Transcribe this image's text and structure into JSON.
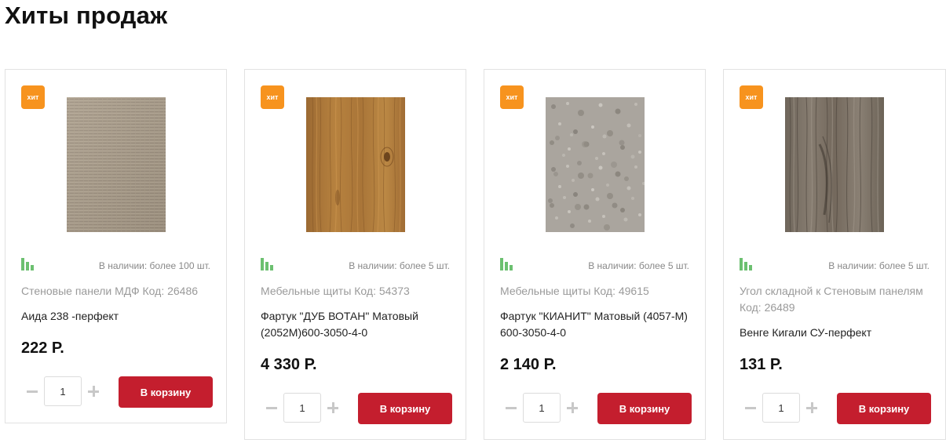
{
  "section": {
    "title": "Хиты продаж"
  },
  "products": [
    {
      "badge": "хит",
      "availability": "В наличии: более 100 шт.",
      "category_code": "Стеновые панели МДФ Код: 26486",
      "name": "Аида 238 -перфект",
      "price": "222 Р.",
      "quantity": "1",
      "cart_label": "В корзину",
      "swatch": {
        "texture": "light-linen-wood",
        "base_color": "#a69886"
      }
    },
    {
      "badge": "хит",
      "availability": "В наличии: более 5 шт.",
      "category_code": "Мебельные щиты Код: 54373",
      "name": "Фартук \"ДУБ ВОТАН\" Матовый (2052М)600-3050-4-0",
      "price": "4 330 Р.",
      "quantity": "1",
      "cart_label": "В корзину",
      "swatch": {
        "texture": "oak-wood",
        "base_color": "#b07a3e"
      }
    },
    {
      "badge": "хит",
      "availability": "В наличии: более 5 шт.",
      "category_code": "Мебельные щиты Код: 49615",
      "name": "Фартук \"КИАНИТ\" Матовый (4057-М) 600-3050-4-0",
      "price": "2 140 Р.",
      "quantity": "1",
      "cart_label": "В корзину",
      "swatch": {
        "texture": "grey-granite-stone",
        "base_color": "#a9a49d"
      }
    },
    {
      "badge": "хит",
      "availability": "В наличии: более 5 шт.",
      "category_code": "Угол складной к Стеновым панелям Код: 26489",
      "name": "Венге Кигали СУ-перфект",
      "price": "131 Р.",
      "quantity": "1",
      "cart_label": "В корзину",
      "swatch": {
        "texture": "grey-wenge-wood",
        "base_color": "#7a7064"
      }
    }
  ],
  "colors": {
    "badge": "#f7931e",
    "cart_button": "#c41e2e",
    "stock_bars": "#6cc070"
  }
}
